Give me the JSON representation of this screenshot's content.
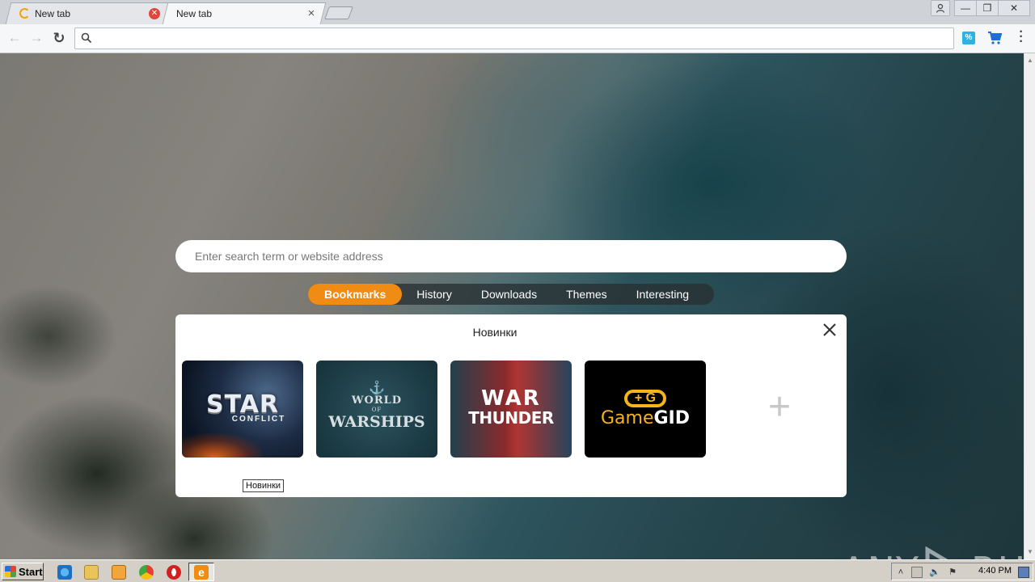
{
  "browser": {
    "tabs": [
      {
        "title": "New tab",
        "loading": true
      },
      {
        "title": "New tab",
        "active": true
      }
    ],
    "address": {
      "value": ""
    },
    "extensions": {
      "percent_label": "%"
    }
  },
  "page": {
    "search": {
      "placeholder": "Enter search term or website address"
    },
    "nav_tabs": [
      {
        "label": "Bookmarks",
        "active": true
      },
      {
        "label": "History"
      },
      {
        "label": "Downloads"
      },
      {
        "label": "Themes"
      },
      {
        "label": "Interesting"
      }
    ],
    "panel": {
      "title": "Новинки",
      "tooltip": "Новинки",
      "tiles": [
        {
          "name": "Star Conflict",
          "line1": "STAR",
          "line2": "CONFLICT"
        },
        {
          "name": "World of Warships",
          "line1": "WORLD",
          "line2": "OF",
          "line3": "WARSHIPS"
        },
        {
          "name": "War Thunder",
          "line1": "WAR",
          "line2": "THUNDER"
        },
        {
          "name": "GameGID",
          "pad": "+ G",
          "text_a": "Game",
          "text_b": "GID"
        }
      ]
    }
  },
  "watermark": {
    "left": "ANY",
    "right": "RUN"
  },
  "taskbar": {
    "start_label": "Start",
    "clock": "4:40 PM"
  },
  "colors": {
    "accent": "#f08b14",
    "tab_bar": "#283032",
    "gamegid": "#f4b41a"
  }
}
